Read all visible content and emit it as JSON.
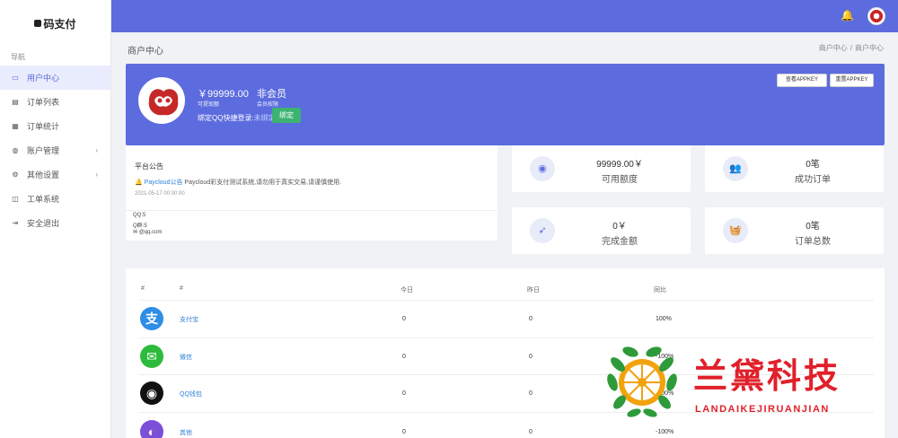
{
  "brand": {
    "name": "码支付"
  },
  "sidebar": {
    "heading": "导航",
    "items": [
      {
        "label": "用户中心",
        "icon": "monitor-icon",
        "active": true
      },
      {
        "label": "订单列表",
        "icon": "list-icon"
      },
      {
        "label": "订单统计",
        "icon": "stats-icon"
      },
      {
        "label": "账户管理",
        "icon": "users-icon",
        "expand": true
      },
      {
        "label": "其他设置",
        "icon": "user-settings-icon",
        "expand": true
      },
      {
        "label": "工单系统",
        "icon": "ticket-icon"
      },
      {
        "label": "安全退出",
        "icon": "logout-icon"
      }
    ]
  },
  "header": {
    "bell": "bell-icon"
  },
  "page": {
    "title": "商户中心",
    "breadcrumb": [
      "商户中心",
      "商户中心"
    ]
  },
  "user_card": {
    "money": "￥99999.00",
    "money_label": "可提现额",
    "member": "非会员",
    "member_label": "会员权限",
    "qq_text": "绑定QQ快捷登录:",
    "qq_status": "未绑定",
    "bind_button": "绑定",
    "key_button_1": "查看APPKEY",
    "key_button_2": "重置APPKEY"
  },
  "notice": {
    "title": "平台公告",
    "author": "Paycloud公告",
    "content": "Paycloud彩支付测试系统,请勿用于真实交易,请谨慎使用.",
    "time": "2021-05-17 00:00:00"
  },
  "contact": {
    "qq": "QQ:5",
    "group": "Q群:5",
    "email": "@qq.com"
  },
  "stats": [
    {
      "value": "99999.00￥",
      "label": "可用额度",
      "icon": "user-circle-icon"
    },
    {
      "value": "0笔",
      "label": "成功订单",
      "icon": "users-icon"
    },
    {
      "value": "0￥",
      "label": "完成金额",
      "icon": "rocket-icon"
    },
    {
      "value": "0笔",
      "label": "订单总数",
      "icon": "basket-icon"
    }
  ],
  "table": {
    "headers": [
      "#",
      "#",
      "今日",
      "昨日",
      "同比"
    ],
    "rows": [
      {
        "name": "支付宝",
        "icon": "alipay-icon",
        "color": "#2e8de5",
        "glyph": "支",
        "today": "0",
        "yesterday": "0",
        "ratio": "100%"
      },
      {
        "name": "微信",
        "icon": "wechat-icon",
        "color": "#2dbb3c",
        "glyph": "✉",
        "today": "0",
        "yesterday": "0",
        "ratio": "-100%"
      },
      {
        "name": "QQ钱包",
        "icon": "qq-icon",
        "color": "#111111",
        "glyph": "◉",
        "today": "0",
        "yesterday": "0",
        "ratio": "-100%"
      },
      {
        "name": "其他",
        "icon": "other-pay-icon",
        "color": "#7b4fd8",
        "glyph": "◐",
        "today": "0",
        "yesterday": "0",
        "ratio": "-100%"
      }
    ]
  },
  "watermark": {
    "name": "兰黛科技",
    "sub": "LANDAIKEJIRUANJIAN"
  }
}
